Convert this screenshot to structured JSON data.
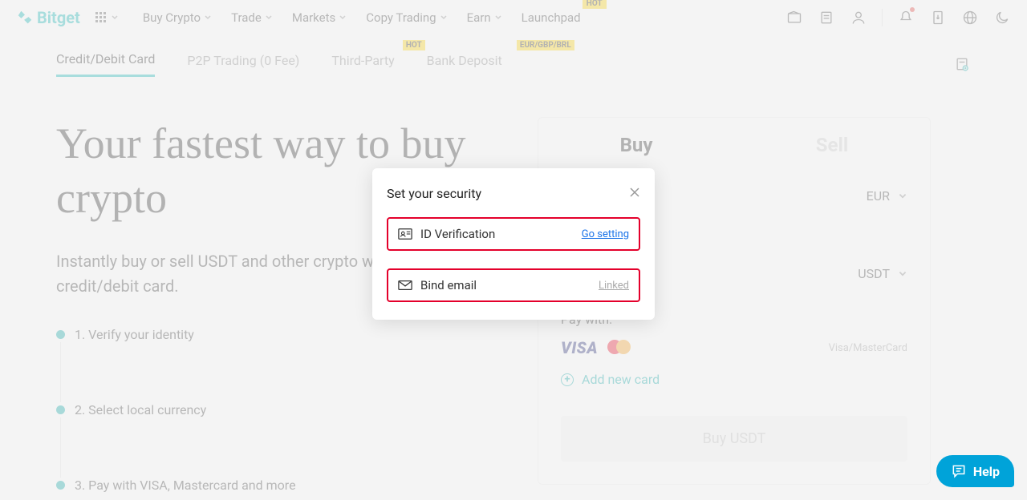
{
  "brand": "Bitget",
  "nav": {
    "items": [
      {
        "label": "Buy Crypto",
        "dropdown": true
      },
      {
        "label": "Trade",
        "dropdown": true
      },
      {
        "label": "Markets",
        "dropdown": true
      },
      {
        "label": "Copy Trading",
        "dropdown": true
      },
      {
        "label": "Earn",
        "dropdown": true
      },
      {
        "label": "Launchpad",
        "dropdown": false,
        "badge": "HOT"
      }
    ]
  },
  "subtabs": {
    "items": [
      {
        "label": "Credit/Debit Card",
        "active": true
      },
      {
        "label": "P2P Trading (0 Fee)"
      },
      {
        "label": "Third-Party",
        "tag": "HOT"
      },
      {
        "label": "Bank Deposit",
        "tag": "EUR/GBP/BRL"
      }
    ]
  },
  "hero": {
    "title": "Your fastest way to buy crypto",
    "subtitle": "Instantly buy or sell USDT and other crypto with your credit/debit card.",
    "steps": [
      "1. Verify your identity",
      "2. Select local currency",
      "3. Pay with VISA, Mastercard and more"
    ]
  },
  "panel": {
    "buy": "Buy",
    "sell": "Sell",
    "fiat": "EUR",
    "crypto": "USDT",
    "paywith": "Pay with:",
    "visa": "VISA",
    "card_label": "Visa/MasterCard",
    "addcard": "Add new card",
    "buybtn": "Buy USDT"
  },
  "modal": {
    "title": "Set your security",
    "row1_label": "ID Verification",
    "row1_action": "Go setting",
    "row2_label": "Bind email",
    "row2_status": "Linked"
  },
  "help": "Help"
}
